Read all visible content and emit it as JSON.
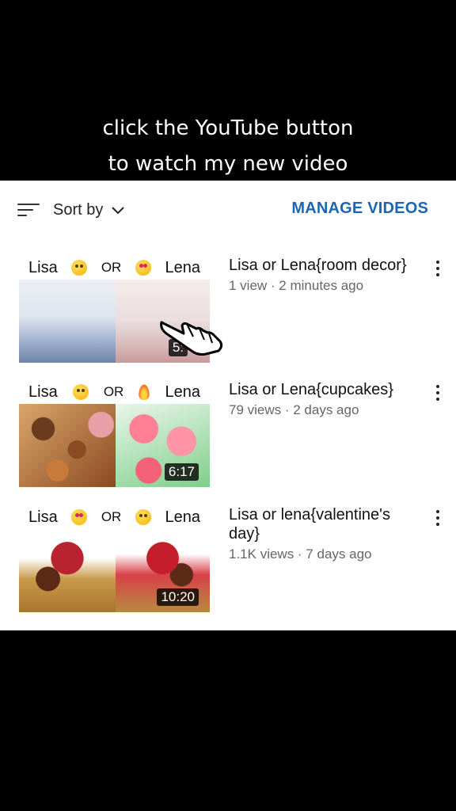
{
  "caption": {
    "line1": "click the YouTube button",
    "line2": "to watch my new video"
  },
  "toolbar": {
    "sort_label": "Sort by",
    "manage_label": "MANAGE VIDEOS"
  },
  "videos": [
    {
      "left_name": "Lisa",
      "or": "OR",
      "right_name": "Lena",
      "duration": "5:",
      "title": "Lisa or Lena{room decor}",
      "meta": "1 view · 2 minutes ago"
    },
    {
      "left_name": "Lisa",
      "or": "OR",
      "right_name": "Lena",
      "duration": "6:17",
      "title": "Lisa or Lena{cupcakes}",
      "meta": "79 views · 2 days ago"
    },
    {
      "left_name": "Lisa",
      "or": "OR",
      "right_name": "Lena",
      "duration": "10:20",
      "title": "Lisa or lena{valentine's day}",
      "meta": "1.1K views · 7 days ago"
    }
  ],
  "icons": {
    "sort": "sort-icon",
    "chevron": "chevron-down-icon",
    "more": "more-vert-icon",
    "cursor": "hand-pointer-icon"
  },
  "colors": {
    "accent": "#1a66b5",
    "background": "#000000",
    "panel": "#ffffff"
  }
}
